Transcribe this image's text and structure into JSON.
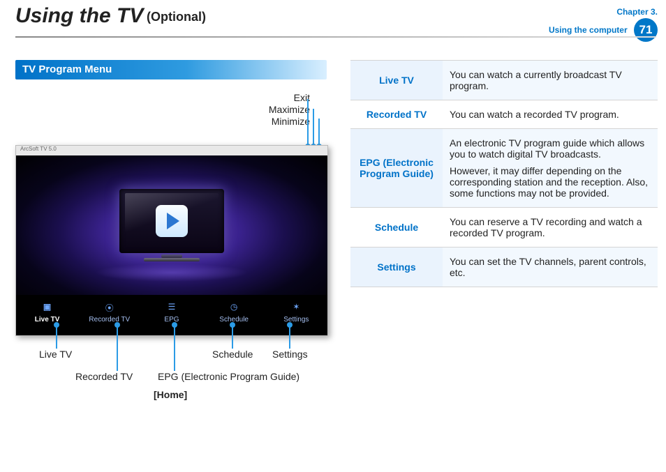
{
  "header": {
    "title": "Using the TV",
    "subtitle": "(Optional)",
    "chapter_line1": "Chapter 3.",
    "chapter_line2": "Using the computer",
    "page_number": "71"
  },
  "section_title": "TV Program Menu",
  "window_controls": {
    "exit": "Exit",
    "maximize": "Maximize",
    "minimize": "Minimize"
  },
  "app_name": "ArcSoft TV 5.0",
  "nav": [
    {
      "label": "Live TV",
      "active": true
    },
    {
      "label": "Recorded TV",
      "active": false
    },
    {
      "label": "EPG",
      "active": false
    },
    {
      "label": "Schedule",
      "active": false
    },
    {
      "label": "Settings",
      "active": false
    }
  ],
  "callouts": {
    "live": "Live TV",
    "recorded": "Recorded TV",
    "epg": "EPG (Electronic Program Guide)",
    "schedule": "Schedule",
    "settings": "Settings"
  },
  "home_caption": "[Home]",
  "defs": [
    {
      "term": "Live TV",
      "desc": [
        "You can watch a currently broadcast TV program."
      ]
    },
    {
      "term": "Recorded TV",
      "desc": [
        "You can watch a recorded TV program."
      ]
    },
    {
      "term": "EPG (Electronic Program Guide)",
      "desc": [
        "An electronic TV program guide which allows you to watch digital TV broadcasts.",
        "However, it may differ depending on the corresponding station and the reception. Also, some functions may not be provided."
      ]
    },
    {
      "term": "Schedule",
      "desc": [
        "You can reserve a TV recording and watch a recorded TV program."
      ]
    },
    {
      "term": "Settings",
      "desc": [
        "You can set the TV channels, parent controls, etc."
      ]
    }
  ]
}
